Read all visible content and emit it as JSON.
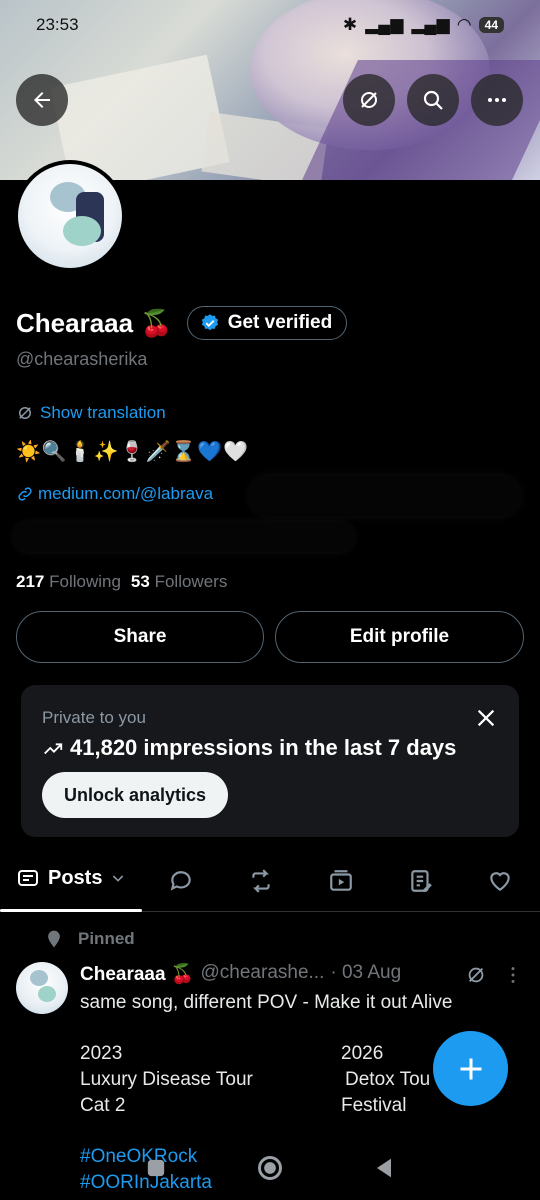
{
  "status_bar": {
    "time": "23:53",
    "battery": "44"
  },
  "profile": {
    "name": "Chearaaa 🍒",
    "get_verified_label": "Get verified",
    "handle": "@chearasherika",
    "translate_label": "Show translation",
    "bio_emojis": "☀️🔍🕯️✨🍷🗡️⌛💙🤍",
    "link": "medium.com/@labrava",
    "following_count": "217",
    "following_label": "Following",
    "followers_count": "53",
    "followers_label": "Followers"
  },
  "actions": {
    "share": "Share",
    "edit_profile": "Edit profile"
  },
  "analytics_card": {
    "label": "Private to you",
    "impressions_text": "41,820 impressions in the last 7 days",
    "unlock_label": "Unlock analytics"
  },
  "tabs": {
    "posts": "Posts"
  },
  "pinned_post": {
    "pinned_label": "Pinned",
    "author": "Chearaaa 🍒",
    "handle": "@chearashe...",
    "date": "· 03 Aug",
    "line1": "same song, different POV - Make it out Alive",
    "col_left": [
      "2023",
      "Luxury Disease Tour",
      "Cat 2"
    ],
    "col_right": [
      "2026",
      "Detox Tou",
      "Festival"
    ],
    "hashtags": [
      "#OneOKRock",
      "#OORInJakarta"
    ]
  },
  "colors": {
    "accent": "#1d9bf0",
    "background": "#000000",
    "muted": "#71767b"
  }
}
